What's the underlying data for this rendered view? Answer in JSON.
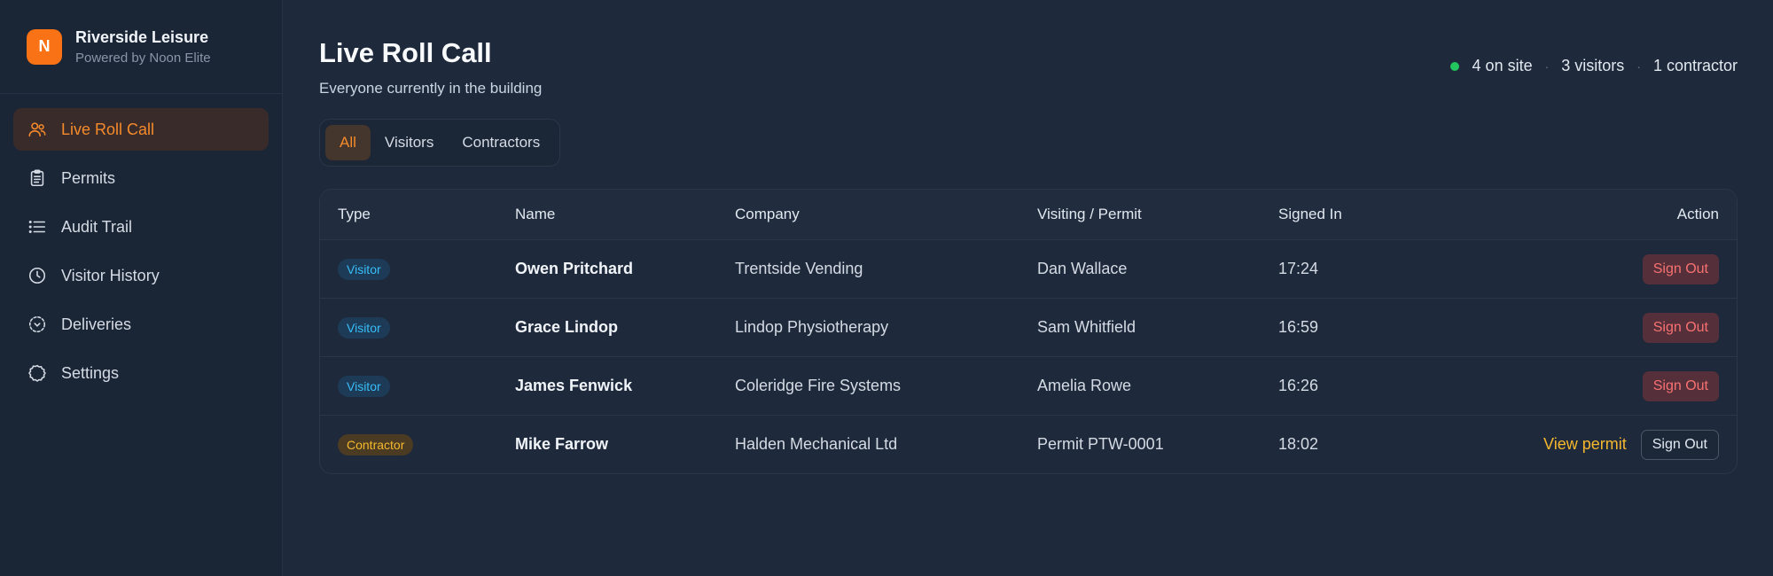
{
  "brand": {
    "logo_letter": "N",
    "name": "Riverside Leisure",
    "sub": "Powered by Noon Elite",
    "accent": "#f97316"
  },
  "nav": [
    {
      "label": "Live Roll Call",
      "icon": "users-icon",
      "active": true
    },
    {
      "label": "Permits",
      "icon": "clipboard-icon"
    },
    {
      "label": "Audit Trail",
      "icon": "list-icon"
    },
    {
      "label": "Visitor History",
      "icon": "clock-icon"
    },
    {
      "label": "Deliveries",
      "icon": "package-icon"
    },
    {
      "label": "Settings",
      "icon": "gear-icon"
    }
  ],
  "header": {
    "title": "Live Roll Call",
    "subtitle": "Everyone currently in the building"
  },
  "stats": {
    "on_site": "4 on site",
    "visitors": "3 visitors",
    "contractors": "1 contractor",
    "status_color": "#22c55e"
  },
  "tabs": [
    {
      "label": "All",
      "active": true
    },
    {
      "label": "Visitors"
    },
    {
      "label": "Contractors"
    }
  ],
  "table": {
    "columns": [
      "Type",
      "Name",
      "Company",
      "Visiting / Permit",
      "Signed In",
      "Action"
    ],
    "rows": [
      {
        "type": "Visitor",
        "name": "Owen Pritchard",
        "company": "Trentside Vending",
        "visiting": "Dan Wallace",
        "signed_in": "17:24",
        "action": "Sign Out"
      },
      {
        "type": "Visitor",
        "name": "Grace Lindop",
        "company": "Lindop Physiotherapy",
        "visiting": "Sam Whitfield",
        "signed_in": "16:59",
        "action": "Sign Out"
      },
      {
        "type": "Visitor",
        "name": "James Fenwick",
        "company": "Coleridge Fire Systems",
        "visiting": "Amelia Rowe",
        "signed_in": "16:26",
        "action": "Sign Out"
      },
      {
        "type": "Contractor",
        "name": "Mike Farrow",
        "company": "Halden Mechanical Ltd",
        "visiting": "Permit PTW-0001",
        "signed_in": "18:02",
        "action": "Sign Out",
        "link": "View permit"
      }
    ]
  }
}
